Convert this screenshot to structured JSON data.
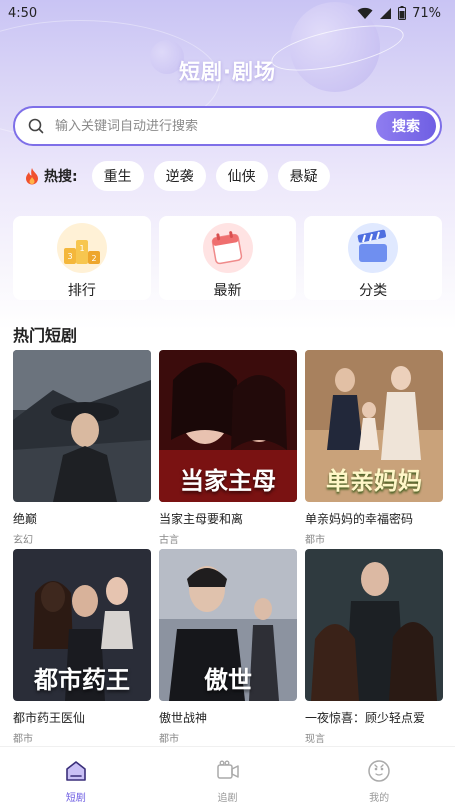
{
  "status": {
    "time": "4:50",
    "battery": "71%"
  },
  "header": {
    "title": "短剧·剧场"
  },
  "search": {
    "placeholder": "输入关键词自动进行搜索",
    "button_label": "搜索"
  },
  "hot": {
    "label": "热搜:",
    "tags": [
      "重生",
      "逆袭",
      "仙侠",
      "悬疑"
    ]
  },
  "categories": [
    {
      "label": "排行",
      "icon": "podium-icon"
    },
    {
      "label": "最新",
      "icon": "calendar-icon"
    },
    {
      "label": "分类",
      "icon": "clapperboard-icon"
    }
  ],
  "section": {
    "title": "热门短剧"
  },
  "dramas": [
    {
      "title": "绝巅",
      "genre": "玄幻"
    },
    {
      "title": "当家主母要和离",
      "genre": "古言",
      "cover_text": "当家主母"
    },
    {
      "title": "单亲妈妈的幸福密码",
      "genre": "都市",
      "cover_text": "单亲妈妈"
    },
    {
      "title": "都市药王医仙",
      "genre": "都市",
      "cover_text": "都市药王"
    },
    {
      "title": "傲世战神",
      "genre": "都市",
      "cover_text": "傲世"
    },
    {
      "title": "一夜惊喜：顾少轻点爱",
      "genre": "现言"
    }
  ],
  "tabs": [
    {
      "label": "短剧",
      "icon": "home-icon",
      "active": true
    },
    {
      "label": "追剧",
      "icon": "video-icon",
      "active": false
    },
    {
      "label": "我的",
      "icon": "profile-icon",
      "active": false
    }
  ],
  "colors": {
    "accent": "#6f5fe3",
    "hero_top": "#c9c4f4"
  }
}
